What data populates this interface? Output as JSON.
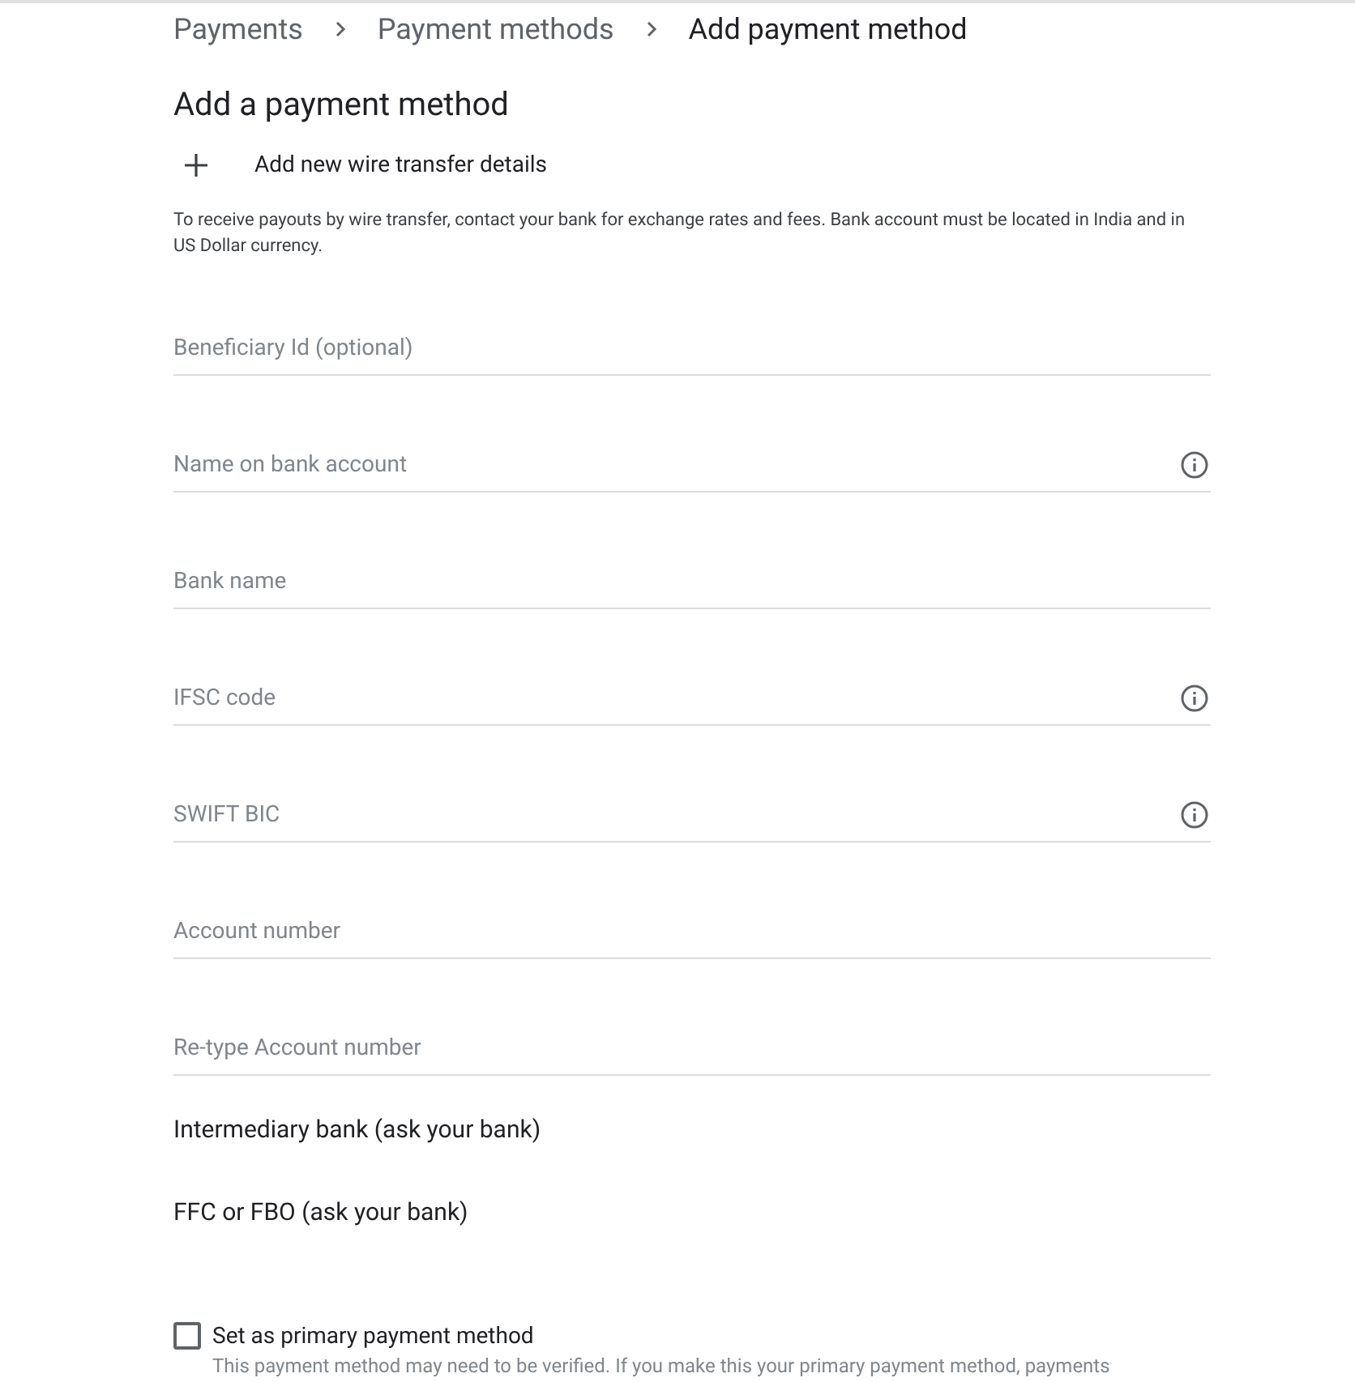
{
  "breadcrumb": [
    "Payments",
    "Payment methods",
    "Add payment method"
  ],
  "title": "Add a payment method",
  "add_action": {
    "label": "Add new wire transfer details"
  },
  "note": "To receive payouts by wire transfer, contact your bank for exchange rates and fees. Bank account must be located in India and in US Dollar currency.",
  "fields": [
    {
      "placeholder": "Beneficiary Id (optional)",
      "info": false
    },
    {
      "placeholder": "Name on bank account",
      "info": true
    },
    {
      "placeholder": "Bank name",
      "info": false
    },
    {
      "placeholder": "IFSC code",
      "info": true
    },
    {
      "placeholder": "SWIFT BIC",
      "info": true
    },
    {
      "placeholder": "Account number",
      "info": false
    },
    {
      "placeholder": "Re-type Account number",
      "info": false
    }
  ],
  "sections": [
    "Intermediary bank (ask your bank)",
    "FFC or FBO (ask your bank)"
  ],
  "primary": {
    "label": "Set as primary payment method",
    "checked": false,
    "hint": "This payment method may need to be verified. If you make this your primary payment method, payments"
  }
}
